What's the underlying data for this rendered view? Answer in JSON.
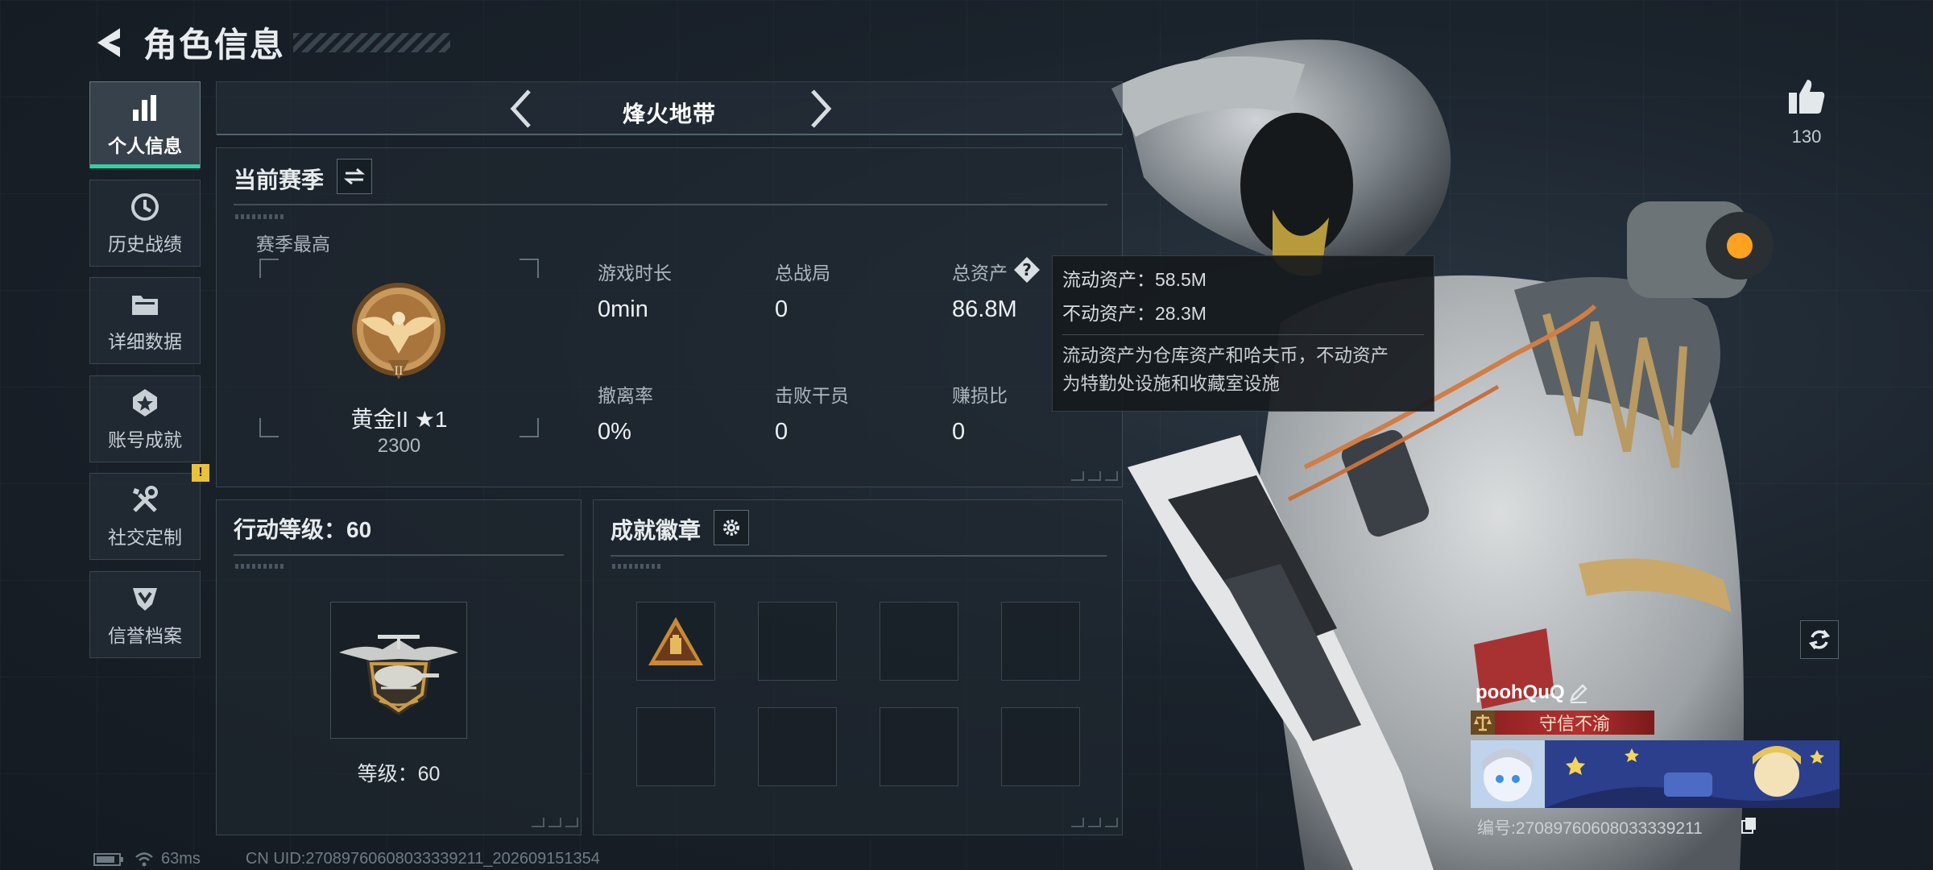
{
  "header": {
    "title": "角色信息"
  },
  "nav": {
    "items": [
      {
        "label": "个人信息",
        "icon": "bar-chart-icon"
      },
      {
        "label": "历史战绩",
        "icon": "history-icon"
      },
      {
        "label": "详细数据",
        "icon": "folder-icon"
      },
      {
        "label": "账号成就",
        "icon": "achievement-icon"
      },
      {
        "label": "社交定制",
        "icon": "tools-icon",
        "badge": "!"
      },
      {
        "label": "信誉档案",
        "icon": "credit-shield-icon"
      }
    ]
  },
  "mode": {
    "title": "烽火地带"
  },
  "season": {
    "title": "当前赛季",
    "best_label": "赛季最高",
    "rank_name": "黄金II ★1",
    "rank_points": "2300",
    "stats": {
      "play_time_label": "游戏时长",
      "play_time_value": "0min",
      "total_matches_label": "总战局",
      "total_matches_value": "0",
      "total_assets_label": "总资产",
      "total_assets_value": "86.8M",
      "extract_rate_label": "撤离率",
      "extract_rate_value": "0%",
      "kills_label": "击败干员",
      "kills_value": "0",
      "profit_ratio_label": "赚损比",
      "profit_ratio_value": "0"
    }
  },
  "tooltip": {
    "liquid": "流动资产：58.5M",
    "fixed": "不动资产：28.3M",
    "desc_line1": "流动资产为仓库资产和哈夫币，不动资产",
    "desc_line2": "为特勤处设施和收藏室设施"
  },
  "level": {
    "title": "行动等级：60",
    "text": "等级：60"
  },
  "badges": {
    "title": "成就徽章"
  },
  "profile": {
    "likes": "130",
    "name": "poohQuQ",
    "title_tag": "守信不渝",
    "id": "编号:270897606080333392​11"
  },
  "statusbar": {
    "ping": "63ms",
    "uid": "CN UID:270897606080333392​11_202609151354"
  },
  "colors": {
    "accent": "#2ed3a5",
    "badge": "#e8c23a",
    "tag": "#b23030"
  }
}
